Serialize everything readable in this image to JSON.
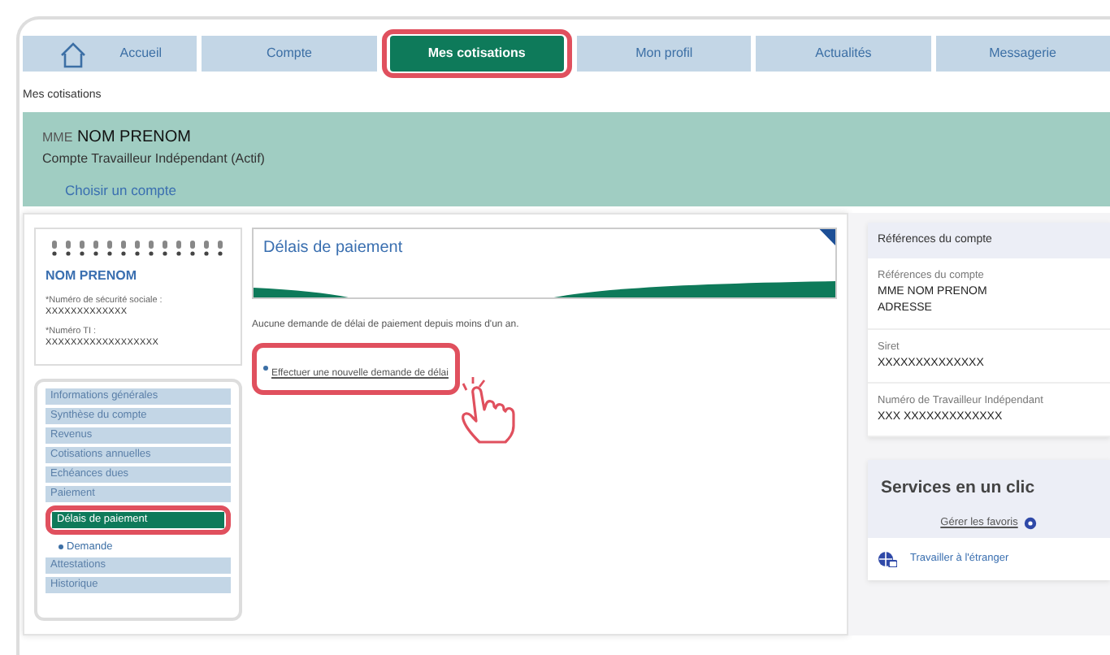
{
  "nav": {
    "tabs": [
      {
        "label": "Accueil",
        "kind": "home",
        "selected": false,
        "highlighted": false
      },
      {
        "label": "Compte",
        "kind": "plain",
        "selected": false,
        "highlighted": false
      },
      {
        "label": "Mes cotisations",
        "kind": "plain",
        "selected": true,
        "highlighted": true
      },
      {
        "label": "Mon profil",
        "kind": "plain",
        "selected": false,
        "highlighted": false
      },
      {
        "label": "Actualités",
        "kind": "plain",
        "selected": false,
        "highlighted": false
      },
      {
        "label": "Messagerie",
        "kind": "plain",
        "selected": false,
        "highlighted": false
      }
    ]
  },
  "breadcrumb": "Mes cotisations",
  "account_banner": {
    "civility": "MME",
    "name": "NOM PRENOM",
    "account_type": "Compte Travailleur Indépendant (Actif)",
    "choose_link": "Choisir un compte"
  },
  "id_card": {
    "name": "NOM PRENOM",
    "fields": [
      {
        "label": "*Numéro de sécurité sociale :",
        "value": "XXXXXXXXXXXXX"
      },
      {
        "label": "*Numéro TI :",
        "value": "XXXXXXXXXXXXXXXXXX"
      }
    ]
  },
  "sidebar": {
    "items": [
      {
        "label": "Informations générales",
        "selected": false,
        "highlighted": false
      },
      {
        "label": "Synthèse du compte",
        "selected": false,
        "highlighted": false
      },
      {
        "label": "Revenus",
        "selected": false,
        "highlighted": false
      },
      {
        "label": "Cotisations annuelles",
        "selected": false,
        "highlighted": false
      },
      {
        "label": "Echéances dues",
        "selected": false,
        "highlighted": false
      },
      {
        "label": "Paiement",
        "selected": false,
        "highlighted": false
      },
      {
        "label": "Délais de paiement",
        "selected": true,
        "highlighted": true,
        "children": [
          {
            "label": "Demande",
            "selected": false,
            "highlighted": false
          }
        ]
      },
      {
        "label": "Attestations",
        "selected": false,
        "highlighted": false
      },
      {
        "label": "Historique",
        "selected": false,
        "highlighted": false
      }
    ]
  },
  "main": {
    "title": "Délais de paiement",
    "message": "Aucune demande de délai de paiement depuis moins d'un an.",
    "link": {
      "label": "Effectuer une nouvelle demande de délai",
      "highlighted": true
    }
  },
  "account_refs": {
    "header": "Références du compte",
    "sections": [
      {
        "label": "Références du compte",
        "lines": [
          "MME NOM PRENOM",
          "ADRESSE"
        ]
      },
      {
        "label": "Siret",
        "lines": [
          "XXXXXXXXXXXXXX"
        ]
      },
      {
        "label": "Numéro de Travailleur Indépendant",
        "lines": [
          "XXX XXXXXXXXXXXXX"
        ]
      }
    ]
  },
  "services": {
    "title": "Services en un clic",
    "manage_link": "Gérer les favoris",
    "items": [
      {
        "label": "Travailler à l'étranger"
      }
    ]
  }
}
